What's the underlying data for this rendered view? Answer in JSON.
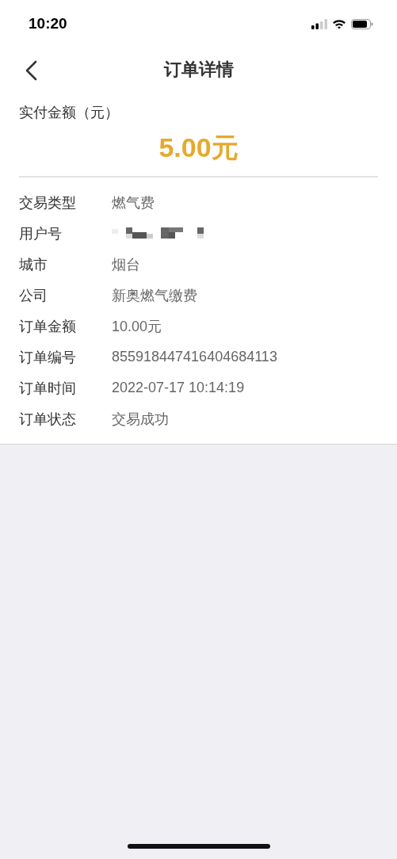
{
  "status_bar": {
    "time": "10:20"
  },
  "nav": {
    "title": "订单详情"
  },
  "payment": {
    "label": "实付金额（元）",
    "amount": "5.00元"
  },
  "details": [
    {
      "kind": "text",
      "label": "交易类型",
      "value": "燃气费"
    },
    {
      "kind": "redacted",
      "label": "用户号"
    },
    {
      "kind": "text",
      "label": "城市",
      "value": "烟台"
    },
    {
      "kind": "text",
      "label": "公司",
      "value": "新奥燃气缴费"
    },
    {
      "kind": "text",
      "label": "订单金额",
      "value": "10.00元"
    },
    {
      "kind": "text",
      "label": "订单编号",
      "value": "855918447416404684113"
    },
    {
      "kind": "text",
      "label": "订单时间",
      "value": "2022-07-17 10:14:19"
    },
    {
      "kind": "text",
      "label": "订单状态",
      "value": "交易成功"
    }
  ]
}
